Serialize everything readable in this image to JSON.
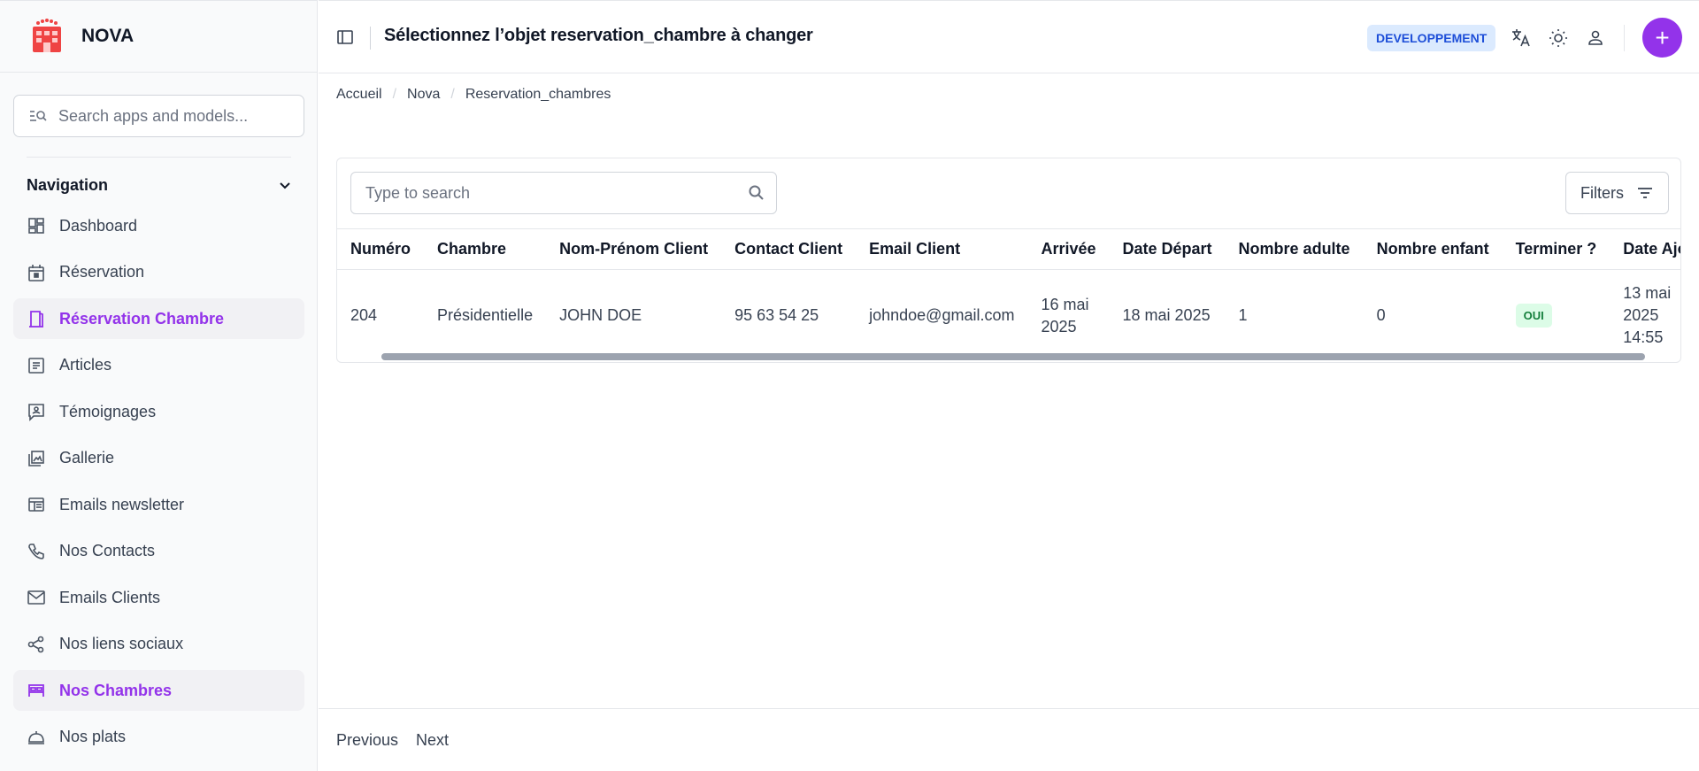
{
  "brand": {
    "name": "NOVA",
    "logo_color": "#ef4444"
  },
  "sidebar": {
    "search_placeholder": "Search apps and models...",
    "nav_title": "Navigation",
    "items": [
      {
        "label": "Dashboard",
        "icon": "dashboard-icon",
        "active": false
      },
      {
        "label": "Réservation",
        "icon": "calendar-icon",
        "active": false
      },
      {
        "label": "Réservation Chambre",
        "icon": "bed-door-icon",
        "active": true
      },
      {
        "label": "Articles",
        "icon": "article-icon",
        "active": false
      },
      {
        "label": "Témoignages",
        "icon": "testimonial-icon",
        "active": false
      },
      {
        "label": "Gallerie",
        "icon": "gallery-icon",
        "active": false
      },
      {
        "label": "Emails newsletter",
        "icon": "newsletter-icon",
        "active": false
      },
      {
        "label": "Nos Contacts",
        "icon": "phone-icon",
        "active": false
      },
      {
        "label": "Emails Clients",
        "icon": "mail-icon",
        "active": false
      },
      {
        "label": "Nos liens sociaux",
        "icon": "share-icon",
        "active": false
      },
      {
        "label": "Nos Chambres",
        "icon": "bed-icon",
        "active": true
      },
      {
        "label": "Nos plats",
        "icon": "dish-icon",
        "active": false
      }
    ]
  },
  "header": {
    "title": "Sélectionnez l’objet reservation_chambre à changer",
    "env_badge": "DEVELOPPEMENT",
    "add_label": "+"
  },
  "breadcrumb": [
    "Accueil",
    "Nova",
    "Reservation_chambres"
  ],
  "table": {
    "search_placeholder": "Type to search",
    "filters_label": "Filters",
    "columns": [
      "Numéro",
      "Chambre",
      "Nom-Prénom Client",
      "Contact Client",
      "Email Client",
      "Arrivée",
      "Date Départ",
      "Nombre adulte",
      "Nombre enfant",
      "Terminer ?",
      "Date Ajout"
    ],
    "rows": [
      {
        "numero": "204",
        "chambre": "Présidentielle",
        "nom": "JOHN DOE",
        "contact": "95 63 54 25",
        "email": "johndoe@gmail.com",
        "arrivee": "16 mai 2025",
        "depart": "18 mai 2025",
        "adultes": "1",
        "enfants": "0",
        "terminer": "OUI",
        "date_ajout": "13 mai 2025 14:55"
      }
    ]
  },
  "pagination": {
    "previous": "Previous",
    "next": "Next"
  },
  "colors": {
    "accent": "#9333ea",
    "badge_bg": "#dbeafe",
    "success": "#15803d"
  }
}
